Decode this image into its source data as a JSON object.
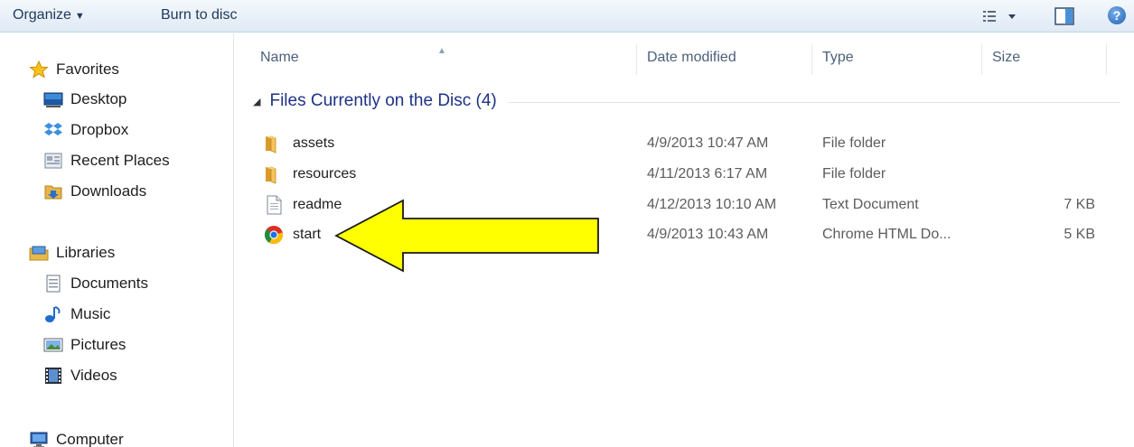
{
  "toolbar": {
    "organize_label": "Organize",
    "burn_label": "Burn to disc"
  },
  "nav": {
    "favorites": {
      "label": "Favorites",
      "items": [
        {
          "label": "Desktop",
          "icon": "desktop-icon"
        },
        {
          "label": "Dropbox",
          "icon": "dropbox-icon"
        },
        {
          "label": "Recent Places",
          "icon": "recent-places-icon"
        },
        {
          "label": "Downloads",
          "icon": "downloads-icon"
        }
      ]
    },
    "libraries": {
      "label": "Libraries",
      "items": [
        {
          "label": "Documents",
          "icon": "documents-icon"
        },
        {
          "label": "Music",
          "icon": "music-icon"
        },
        {
          "label": "Pictures",
          "icon": "pictures-icon"
        },
        {
          "label": "Videos",
          "icon": "videos-icon"
        }
      ]
    },
    "computer": {
      "label": "Computer"
    }
  },
  "columns": {
    "name": "Name",
    "date_modified": "Date modified",
    "type": "Type",
    "size": "Size"
  },
  "group": {
    "title": "Files Currently on the Disc (4)"
  },
  "files": [
    {
      "name": "assets",
      "date": "4/9/2013 10:47 AM",
      "type": "File folder",
      "size": "",
      "icon": "folder-icon"
    },
    {
      "name": "resources",
      "date": "4/11/2013 6:17 AM",
      "type": "File folder",
      "size": "",
      "icon": "folder-icon"
    },
    {
      "name": "readme",
      "date": "4/12/2013 10:10 AM",
      "type": "Text Document",
      "size": "7 KB",
      "icon": "text-document-icon"
    },
    {
      "name": "start",
      "date": "4/9/2013 10:43 AM",
      "type": "Chrome HTML Do...",
      "size": "5 KB",
      "icon": "chrome-icon"
    }
  ],
  "annotation": {
    "arrow_color": "#ffff00",
    "arrow_target": "start"
  },
  "colors": {
    "toolbar_text": "#1e395b",
    "group_title": "#1e3287",
    "column_header": "#4c607a"
  }
}
